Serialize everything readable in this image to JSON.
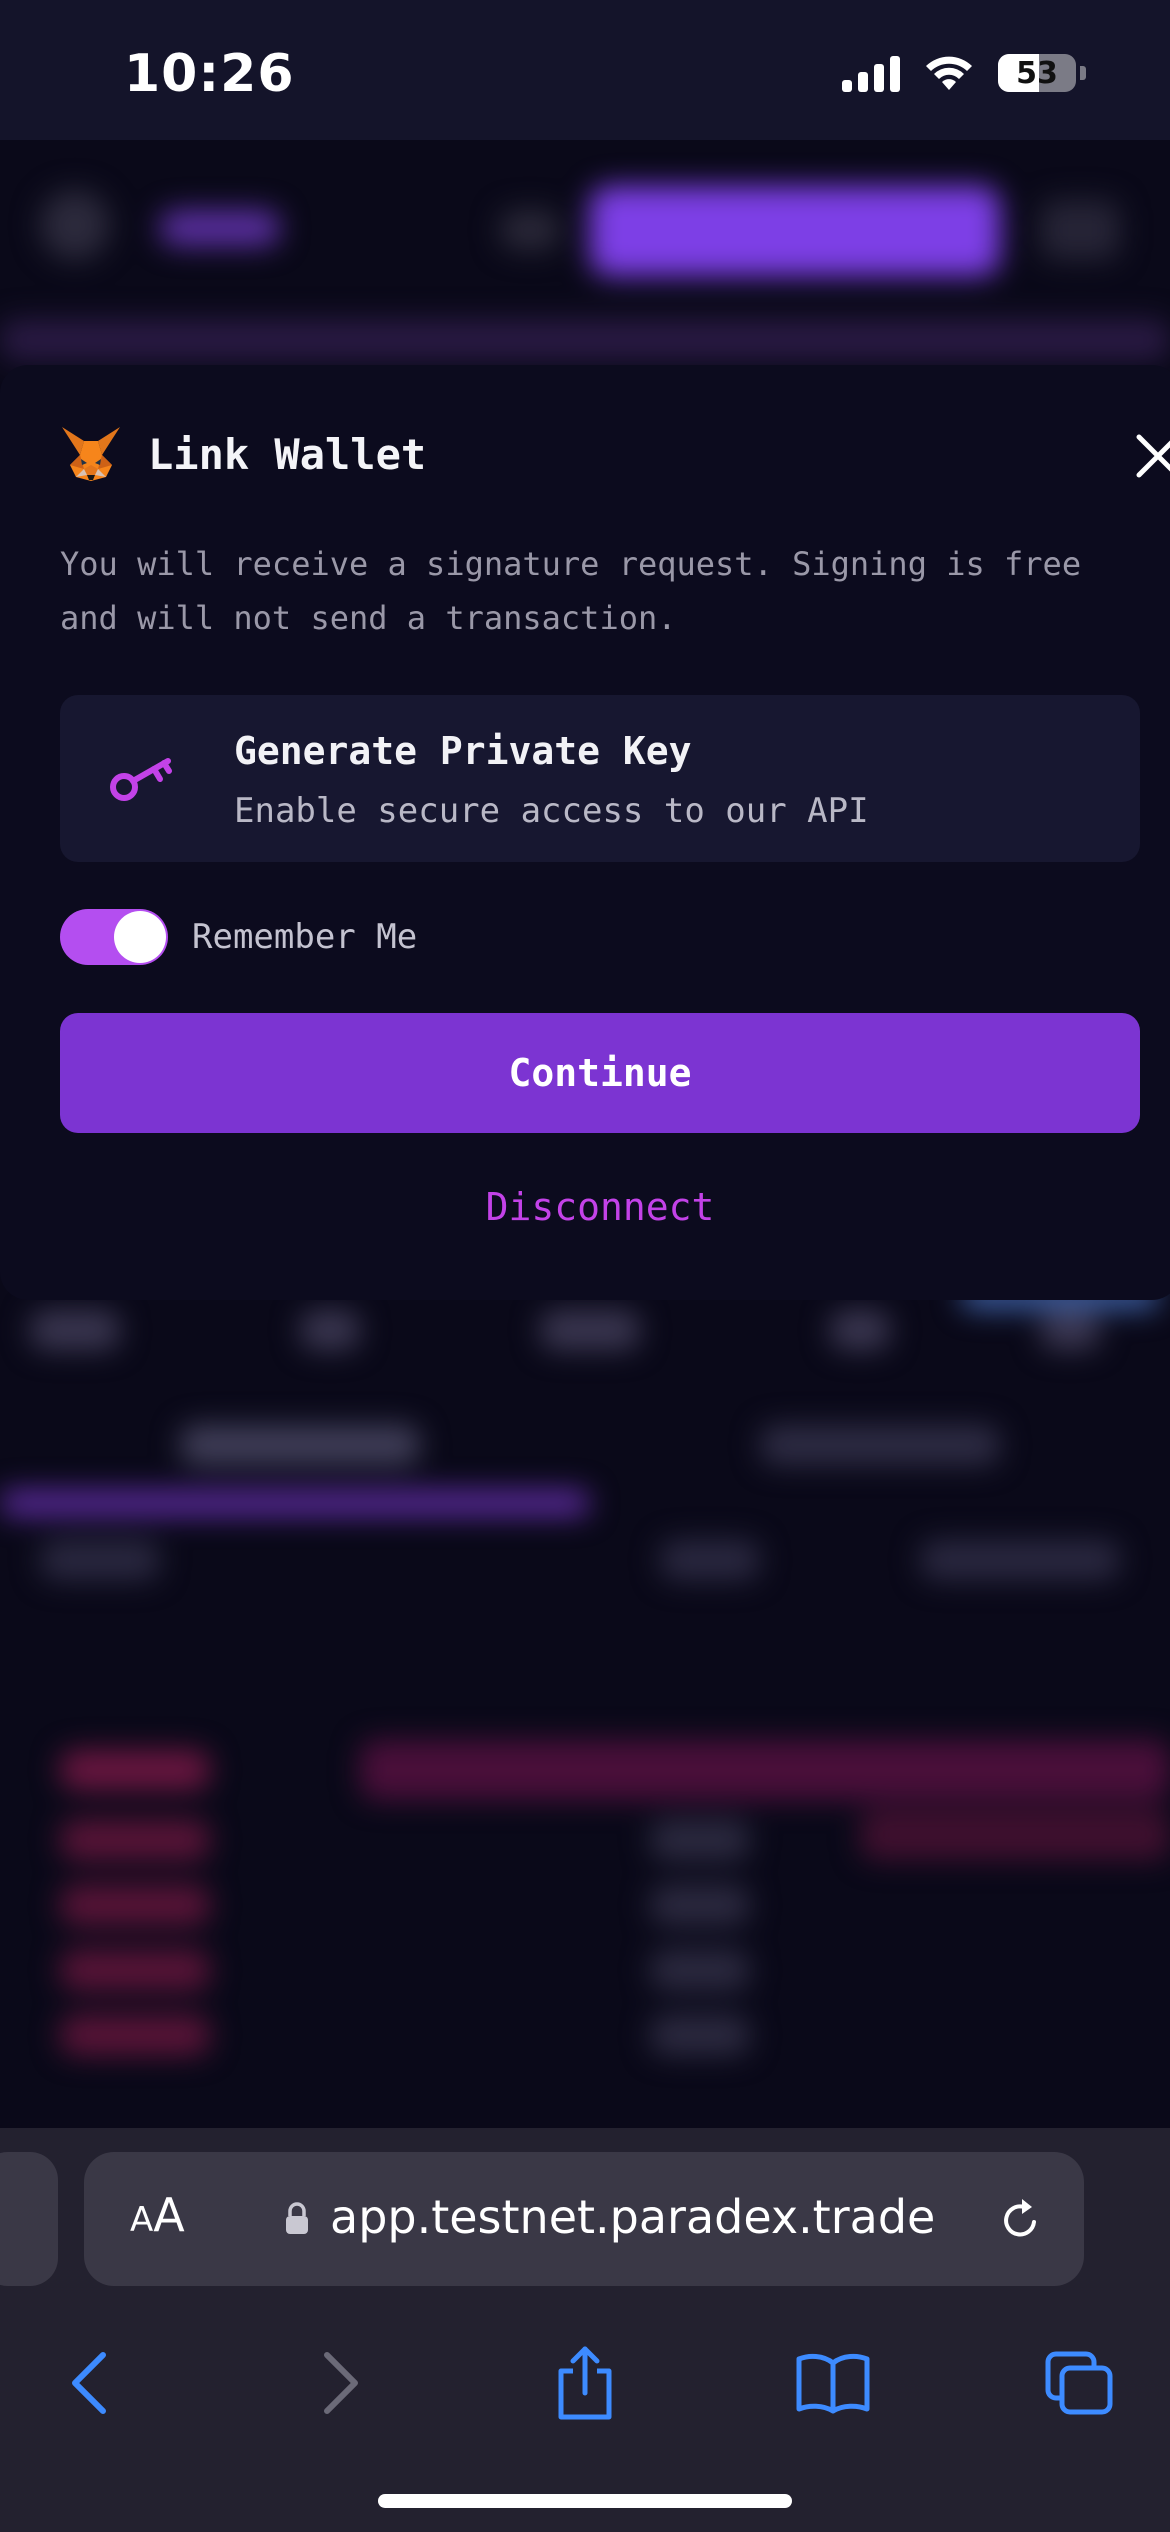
{
  "status_bar": {
    "time": "10:26",
    "battery_level": "53"
  },
  "modal": {
    "title": "Link Wallet",
    "description": "You will receive a signature request. Signing is free and will not send a transaction.",
    "key_card": {
      "title": "Generate Private Key",
      "subtitle": "Enable secure access to our API"
    },
    "remember_me": {
      "label": "Remember Me",
      "enabled": true
    },
    "continue_label": "Continue",
    "disconnect_label": "Disconnect"
  },
  "browser": {
    "text_size_small": "A",
    "text_size_large": "A",
    "url": "app.testnet.paradex.trade"
  },
  "colors": {
    "accent_purple": "#7c34d2",
    "toggle_on": "#b44ef0",
    "link_magenta": "#c342e8",
    "modal_bg": "#0c0b1e"
  }
}
